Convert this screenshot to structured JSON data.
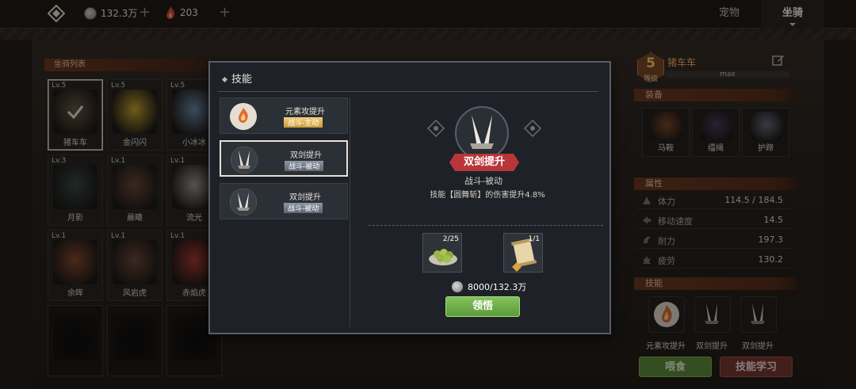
{
  "topbar": {
    "silver": "132.3万",
    "gems": "203",
    "tabs": [
      {
        "label": "宠物"
      },
      {
        "label": "坐骑"
      }
    ],
    "active_tab": "坐骑"
  },
  "mount_list": {
    "header": "坐骑列表",
    "mounts": [
      {
        "level": "Lv.5",
        "name": "猪车车",
        "selected": true,
        "color": "#6a5848"
      },
      {
        "level": "Lv.5",
        "name": "金闪闪",
        "color": "#c9a631"
      },
      {
        "level": "Lv.5",
        "name": "小冰冰",
        "color": "#6e8aa6"
      },
      {
        "level": "Lv.3",
        "name": "月影",
        "color": "#3a4a48"
      },
      {
        "level": "Lv.1",
        "name": "晨曦",
        "color": "#6b4a3a"
      },
      {
        "level": "Lv.1",
        "name": "流光",
        "color": "#9a9894"
      },
      {
        "level": "Lv.1",
        "name": "余晖",
        "color": "#8a4a32"
      },
      {
        "level": "Lv.1",
        "name": "风岩虎",
        "color": "#6e4a3e"
      },
      {
        "level": "Lv.1",
        "name": "赤焰虎",
        "color": "#a83a32"
      }
    ]
  },
  "detail": {
    "level": "5",
    "level_caption": "等级",
    "name": "猪车车",
    "max_label": "max",
    "equip_header": "装备",
    "equipment": [
      {
        "name": "马鞍",
        "color": "#7a4a2a"
      },
      {
        "name": "缰绳",
        "color": "#4a3a5a"
      },
      {
        "name": "护蹄",
        "color": "#6a6a7a"
      }
    ],
    "attr_header": "属性",
    "stats": [
      {
        "label": "体力",
        "value": "114.5 / 184.5"
      },
      {
        "label": "移动速度",
        "value": "14.5"
      },
      {
        "label": "耐力",
        "value": "197.3"
      },
      {
        "label": "疲劳",
        "value": "130.2"
      }
    ],
    "skills_header": "技能",
    "skills": [
      {
        "name": "元素攻提升"
      },
      {
        "name": "双剑提升"
      },
      {
        "name": "双剑提升"
      }
    ],
    "feed_button": "喂食",
    "learn_button": "技能学习"
  },
  "modal": {
    "title": "技能",
    "skills": [
      {
        "name": "元素攻提升",
        "tag": "战斗-主动",
        "kind": "active"
      },
      {
        "name": "双剑提升",
        "tag": "战斗-被动",
        "kind": "passive"
      },
      {
        "name": "双剑提升",
        "tag": "战斗-被动",
        "kind": "passive"
      }
    ],
    "selected": {
      "name": "双剑提升",
      "type": "战斗-被动",
      "description": "技能【圆舞斩】的伤害提升4.8%"
    },
    "materials": [
      {
        "count": "2/25",
        "icon": "olive-bowl-icon"
      },
      {
        "count": "1/1",
        "icon": "scroll-icon"
      }
    ],
    "cost": "8000/132.3万",
    "learn_button": "领悟"
  }
}
